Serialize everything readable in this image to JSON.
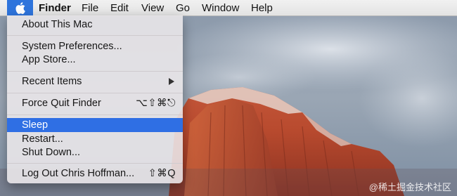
{
  "menubar": {
    "apple_icon": "apple-logo-icon",
    "items": [
      "Finder",
      "File",
      "Edit",
      "View",
      "Go",
      "Window",
      "Help"
    ]
  },
  "apple_menu": {
    "about": "About This Mac",
    "system_prefs": "System Preferences...",
    "app_store": "App Store...",
    "recent_items": "Recent Items",
    "force_quit": "Force Quit Finder",
    "force_quit_shortcut": "⌥⇧⌘⎋",
    "sleep": "Sleep",
    "restart": "Restart...",
    "shut_down": "Shut Down...",
    "log_out": "Log Out Chris Hoffman...",
    "log_out_shortcut": "⇧⌘Q",
    "selected_item": "Sleep"
  },
  "watermark": "@稀土掘金技术社区",
  "colors": {
    "menu_highlight": "#2f6fe4",
    "apple_highlight": "#2e74dc"
  }
}
